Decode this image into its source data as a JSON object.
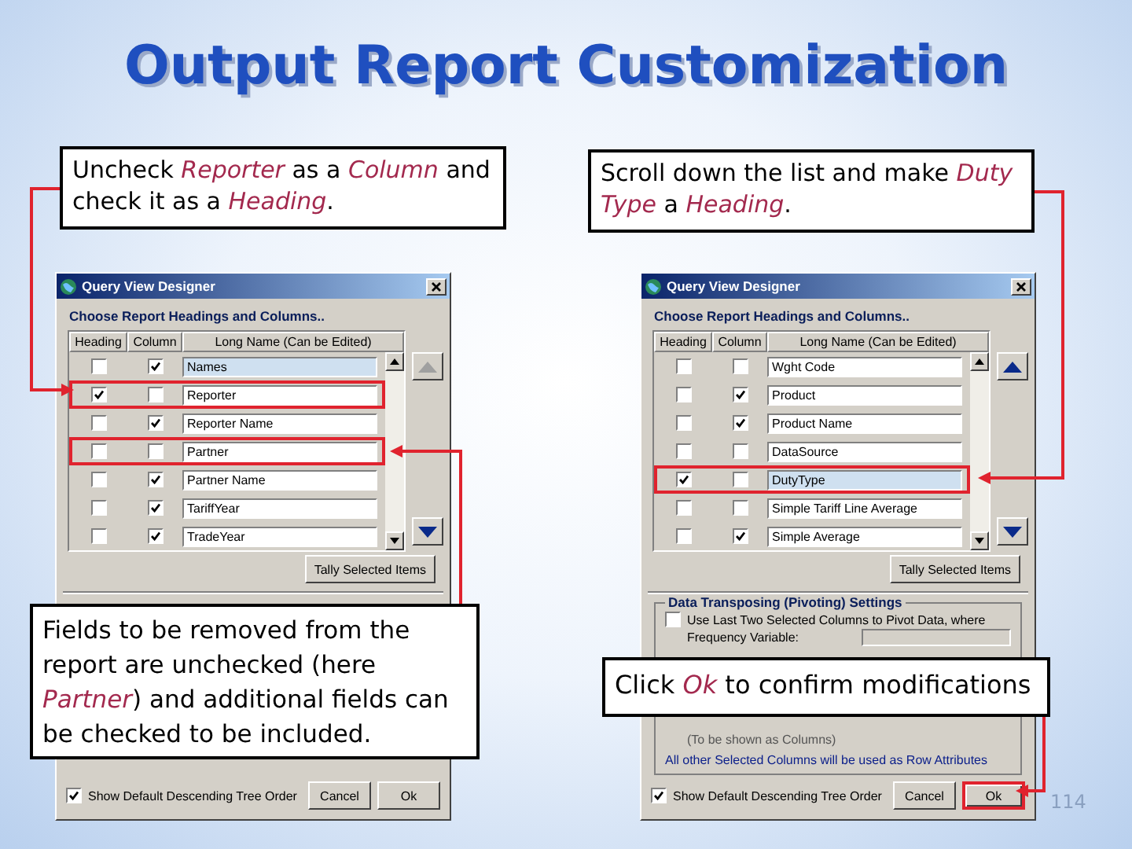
{
  "title": "Output Report Customization",
  "callouts": [
    {
      "text": "Uncheck *Reporter* as a *Column* and check it as a *Heading*."
    },
    {
      "text": "Scroll down the list and make *Duty Type* a *Heading*."
    },
    {
      "text": "Fields to be removed from the report are unchecked (here *Partner*) and additional fields can be checked to be included."
    },
    {
      "text": "Click *Ok* to confirm modifications"
    }
  ],
  "dialogs": [
    {
      "title": "Query View Designer",
      "section_label": "Choose Report Headings and Columns..",
      "columns": [
        "Heading",
        "Column",
        "Long Name (Can be Edited)"
      ],
      "scroll_up_disabled": true,
      "rows": [
        {
          "heading_checked": false,
          "column_checked": true,
          "name": "Names",
          "selected": true,
          "highlighted": false
        },
        {
          "heading_checked": true,
          "column_checked": false,
          "name": "Reporter",
          "selected": false,
          "highlighted": true
        },
        {
          "heading_checked": false,
          "column_checked": true,
          "name": "Reporter Name",
          "selected": false,
          "highlighted": false
        },
        {
          "heading_checked": false,
          "column_checked": false,
          "name": "Partner",
          "selected": false,
          "highlighted": true
        },
        {
          "heading_checked": false,
          "column_checked": true,
          "name": "Partner Name",
          "selected": false,
          "highlighted": false
        },
        {
          "heading_checked": false,
          "column_checked": true,
          "name": "TariffYear",
          "selected": false,
          "highlighted": false
        },
        {
          "heading_checked": false,
          "column_checked": true,
          "name": "TradeYear",
          "selected": false,
          "highlighted": false
        }
      ],
      "tally_button": "Tally Selected Items",
      "show_default": {
        "label": "Show Default Descending Tree Order",
        "checked": true
      },
      "cancel_button": "Cancel",
      "ok_button": {
        "label": "Ok",
        "highlighted": false
      }
    },
    {
      "title": "Query View Designer",
      "section_label": "Choose Report Headings and Columns..",
      "columns": [
        "Heading",
        "Column",
        "Long Name (Can be Edited)"
      ],
      "scroll_up_disabled": false,
      "rows": [
        {
          "heading_checked": false,
          "column_checked": false,
          "name": "Wght Code",
          "selected": false,
          "highlighted": false
        },
        {
          "heading_checked": false,
          "column_checked": true,
          "name": "Product",
          "selected": false,
          "highlighted": false
        },
        {
          "heading_checked": false,
          "column_checked": true,
          "name": "Product Name",
          "selected": false,
          "highlighted": false
        },
        {
          "heading_checked": false,
          "column_checked": false,
          "name": "DataSource",
          "selected": false,
          "highlighted": false
        },
        {
          "heading_checked": true,
          "column_checked": false,
          "name": "DutyType",
          "selected": true,
          "highlighted": true
        },
        {
          "heading_checked": false,
          "column_checked": false,
          "name": "Simple Tariff Line Average",
          "selected": false,
          "highlighted": false
        },
        {
          "heading_checked": false,
          "column_checked": true,
          "name": "Simple Average",
          "selected": false,
          "highlighted": false
        }
      ],
      "tally_button": "Tally Selected Items",
      "pivot": {
        "label": "Data Transposing (Pivoting) Settings",
        "option": {
          "label": "Use Last Two Selected Columns to Pivot Data, where",
          "checked": false
        },
        "frequency_label": "Frequency Variable:",
        "columns_note": "(To be shown as Columns)",
        "note": "All other Selected Columns will be used as Row Attributes"
      },
      "show_default": {
        "label": "Show Default Descending Tree Order",
        "checked": true
      },
      "cancel_button": "Cancel",
      "ok_button": {
        "label": "Ok",
        "highlighted": true
      }
    }
  ],
  "page_number": "114"
}
